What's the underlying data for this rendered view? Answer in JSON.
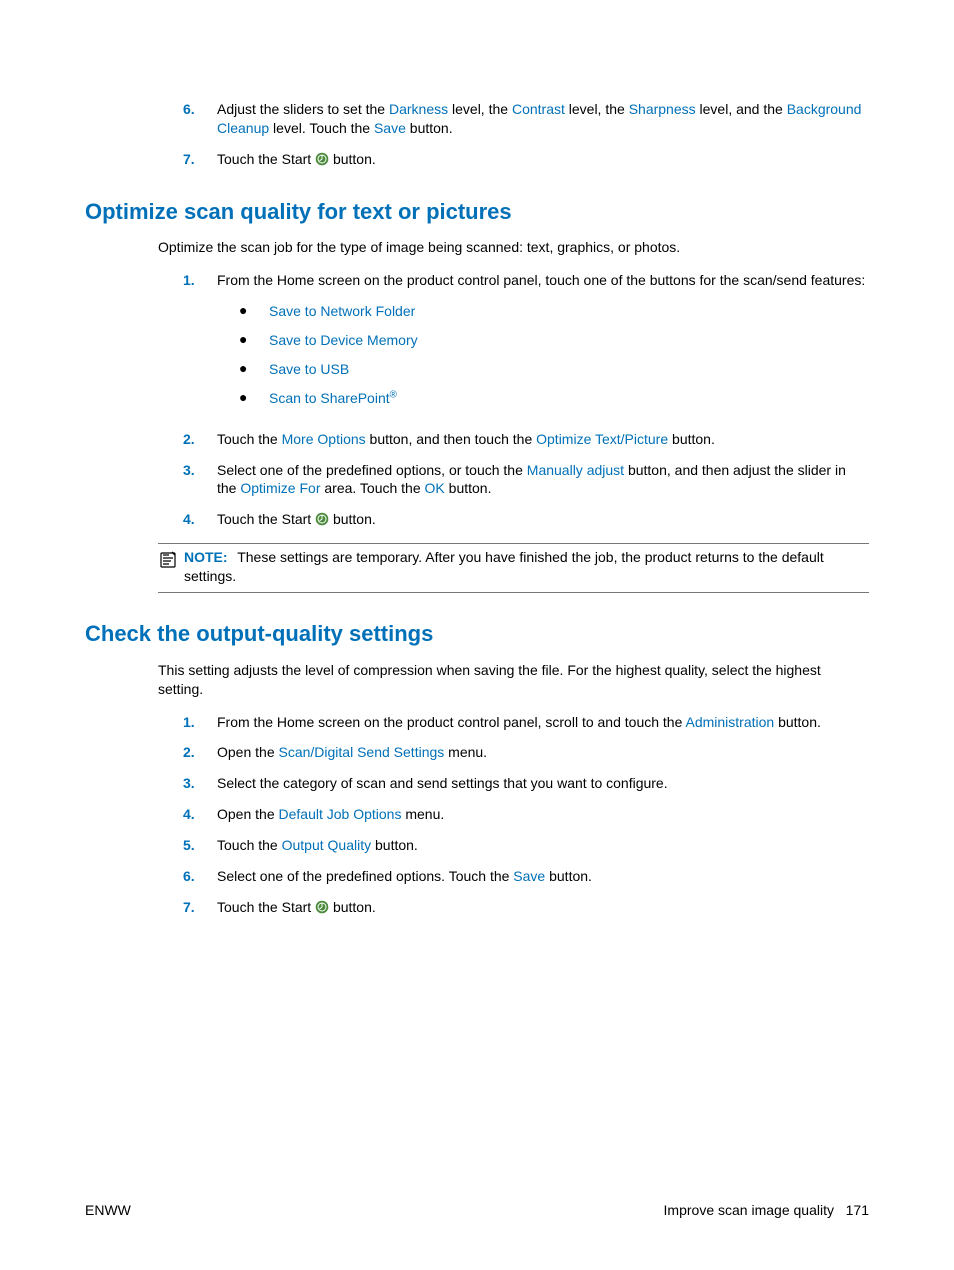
{
  "pre_steps": [
    {
      "num": "6.",
      "parts": [
        {
          "t": "Adjust the sliders to set the "
        },
        {
          "t": "Darkness",
          "link": true
        },
        {
          "t": " level, the "
        },
        {
          "t": "Contrast",
          "link": true
        },
        {
          "t": " level, the "
        },
        {
          "t": "Sharpness",
          "link": true
        },
        {
          "t": " level, and the "
        },
        {
          "t": "Background Cleanup",
          "link": true
        },
        {
          "t": " level. Touch the "
        },
        {
          "t": "Save",
          "link": true
        },
        {
          "t": " button."
        }
      ]
    },
    {
      "num": "7.",
      "parts": [
        {
          "t": "Touch the Start "
        },
        {
          "icon": "start"
        },
        {
          "t": " button."
        }
      ]
    }
  ],
  "section_optimize": {
    "heading": "Optimize scan quality for text or pictures",
    "intro": "Optimize the scan job for the type of image being scanned: text, graphics, or photos.",
    "steps": [
      {
        "num": "1.",
        "parts": [
          {
            "t": "From the Home screen on the product control panel, touch one of the buttons for the scan/send features:"
          }
        ],
        "bullets": [
          "Save to Network Folder",
          "Save to Device Memory",
          "Save to USB",
          "Scan to SharePoint®"
        ]
      },
      {
        "num": "2.",
        "parts": [
          {
            "t": "Touch the "
          },
          {
            "t": "More Options",
            "link": true
          },
          {
            "t": " button, and then touch the "
          },
          {
            "t": "Optimize Text/Picture",
            "link": true
          },
          {
            "t": " button."
          }
        ]
      },
      {
        "num": "3.",
        "parts": [
          {
            "t": "Select one of the predefined options, or touch the "
          },
          {
            "t": "Manually adjust",
            "link": true
          },
          {
            "t": " button, and then adjust the slider in the "
          },
          {
            "t": "Optimize For",
            "link": true
          },
          {
            "t": " area. Touch the "
          },
          {
            "t": "OK",
            "link": true
          },
          {
            "t": " button."
          }
        ]
      },
      {
        "num": "4.",
        "parts": [
          {
            "t": "Touch the Start "
          },
          {
            "icon": "start"
          },
          {
            "t": " button."
          }
        ]
      }
    ],
    "note_label": "NOTE:",
    "note_text": "These settings are temporary. After you have finished the job, the product returns to the default settings."
  },
  "section_output": {
    "heading": "Check the output-quality settings",
    "intro": "This setting adjusts the level of compression when saving the file. For the highest quality, select the highest setting.",
    "steps": [
      {
        "num": "1.",
        "parts": [
          {
            "t": "From the Home screen on the product control panel, scroll to and touch the "
          },
          {
            "t": "Administration",
            "link": true
          },
          {
            "t": " button."
          }
        ]
      },
      {
        "num": "2.",
        "parts": [
          {
            "t": "Open the "
          },
          {
            "t": "Scan/Digital Send Settings",
            "link": true
          },
          {
            "t": " menu."
          }
        ]
      },
      {
        "num": "3.",
        "parts": [
          {
            "t": "Select the category of scan and send settings that you want to configure."
          }
        ]
      },
      {
        "num": "4.",
        "parts": [
          {
            "t": "Open the "
          },
          {
            "t": "Default Job Options",
            "link": true
          },
          {
            "t": " menu."
          }
        ]
      },
      {
        "num": "5.",
        "parts": [
          {
            "t": "Touch the "
          },
          {
            "t": "Output Quality",
            "link": true
          },
          {
            "t": " button."
          }
        ]
      },
      {
        "num": "6.",
        "parts": [
          {
            "t": "Select one of the predefined options. Touch the "
          },
          {
            "t": "Save",
            "link": true
          },
          {
            "t": " button."
          }
        ]
      },
      {
        "num": "7.",
        "parts": [
          {
            "t": "Touch the Start "
          },
          {
            "icon": "start"
          },
          {
            "t": " button."
          }
        ]
      }
    ]
  },
  "footer": {
    "left": "ENWW",
    "right_text": "Improve scan image quality",
    "page_num": "171"
  }
}
